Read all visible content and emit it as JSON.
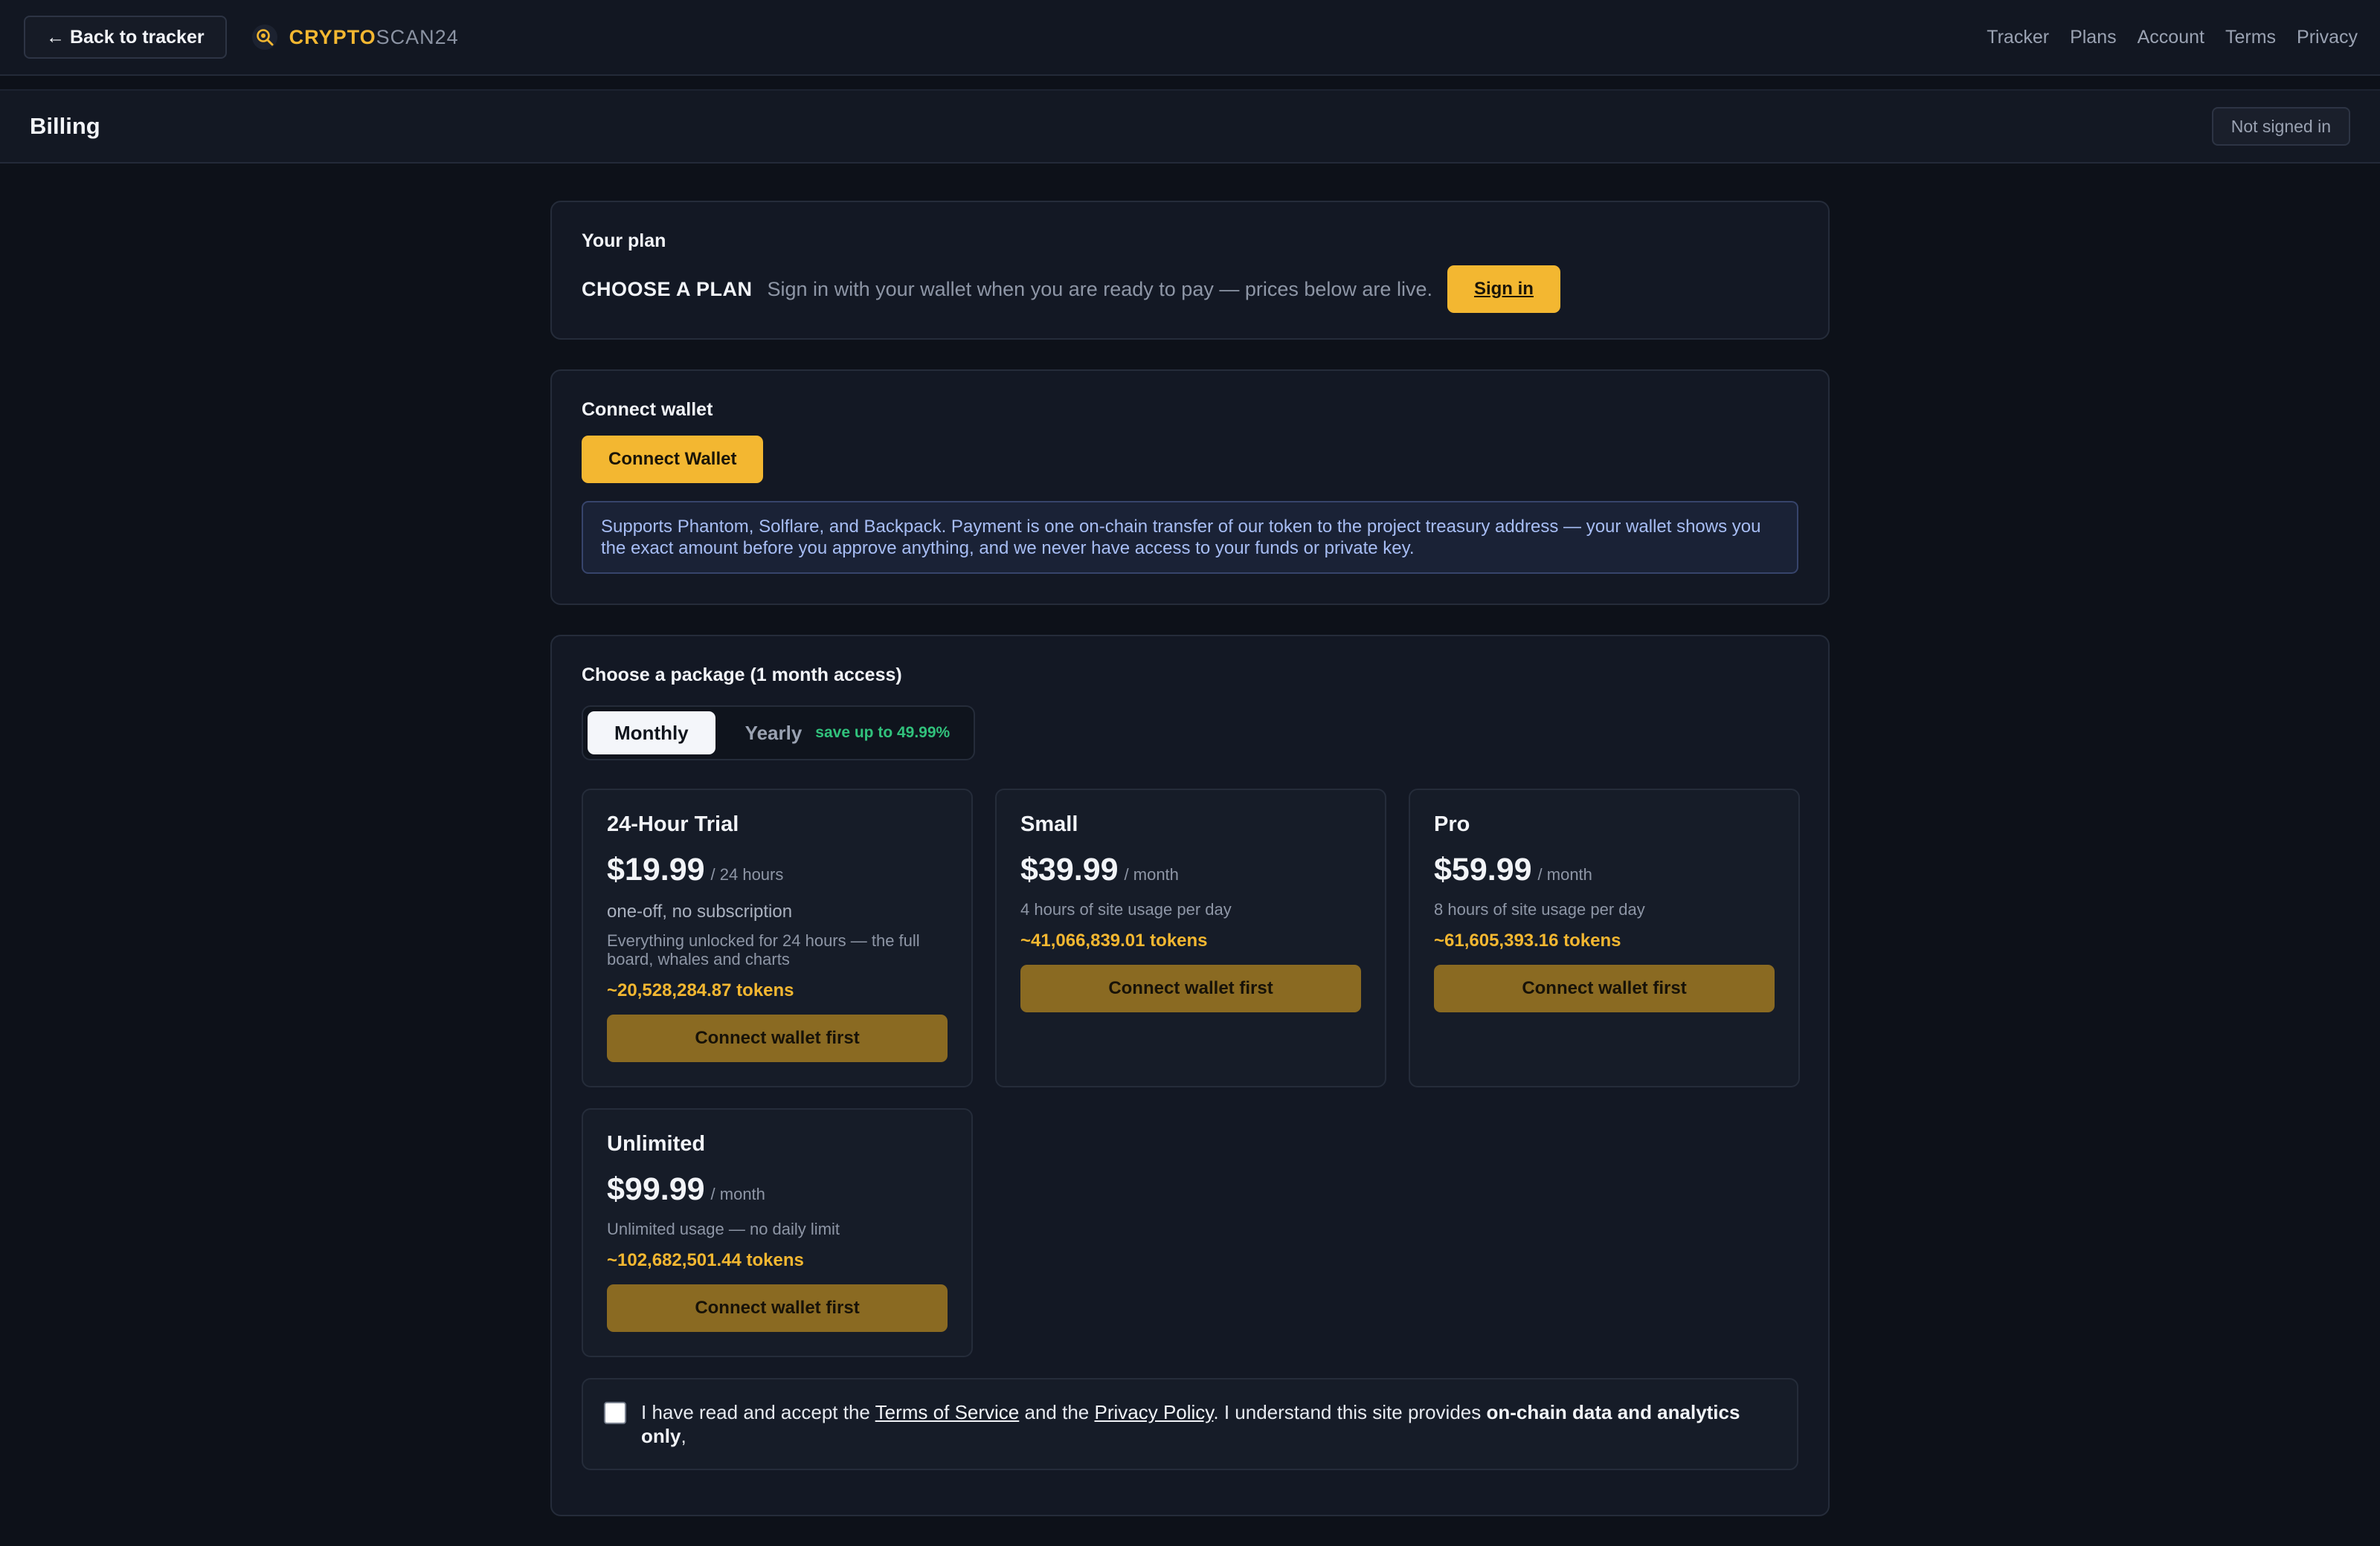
{
  "nav": {
    "back_label": "← Back to tracker",
    "brand_primary": "CRYPTO",
    "brand_secondary": "SCAN24",
    "links": [
      "Tracker",
      "Plans",
      "Account",
      "Terms",
      "Privacy"
    ]
  },
  "billing": {
    "title": "Billing",
    "status_badge": "Not signed in"
  },
  "plan": {
    "title": "Your plan",
    "current": "CHOOSE A PLAN",
    "hint": "Sign in with your wallet when you are ready to pay — prices below are live.",
    "signin_label": "Sign in"
  },
  "wallet": {
    "title": "Connect wallet",
    "button": "Connect Wallet",
    "info": "Supports Phantom, Solflare, and Backpack. Payment is one on-chain transfer of our token to the project treasury address — your wallet shows you the exact amount before you approve anything, and we never have access to your funds or private key."
  },
  "packages": {
    "title": "Choose a package (1 month access)",
    "toggle": {
      "monthly": "Monthly",
      "yearly": "Yearly",
      "save_tag": "save up to 49.99%",
      "selected": "Monthly"
    },
    "items": [
      {
        "name": "24-Hour Trial",
        "price": "$19.99",
        "period": "/ 24 hours",
        "sub": "one-off, no subscription",
        "desc": "Everything unlocked for 24 hours — the full board, whales and charts",
        "tokens": "~20,528,284.87 tokens",
        "button": "Connect wallet first"
      },
      {
        "name": "Small",
        "price": "$39.99",
        "period": "/ month",
        "desc": "4 hours of site usage per day",
        "tokens": "~41,066,839.01 tokens",
        "button": "Connect wallet first"
      },
      {
        "name": "Pro",
        "price": "$59.99",
        "period": "/ month",
        "desc": "8 hours of site usage per day",
        "tokens": "~61,605,393.16 tokens",
        "button": "Connect wallet first"
      },
      {
        "name": "Unlimited",
        "price": "$99.99",
        "period": "/ month",
        "desc": "Unlimited usage — no daily limit",
        "tokens": "~102,682,501.44 tokens",
        "button": "Connect wallet first"
      }
    ]
  },
  "terms": {
    "prefix": "I have read and accept the",
    "tos": "Terms of Service",
    "and": "and the",
    "privacy": "Privacy Policy",
    "middle": ". I understand this site provides",
    "bold": "on-chain data and analytics only",
    "suffix": ",",
    "checked": false
  },
  "icons": {
    "brand": "magnifier-coin-icon"
  },
  "colors": {
    "accent": "#f3b731",
    "background": "#0d1119",
    "save_green": "#31c27c",
    "info_blue": "#a7bdf4"
  }
}
